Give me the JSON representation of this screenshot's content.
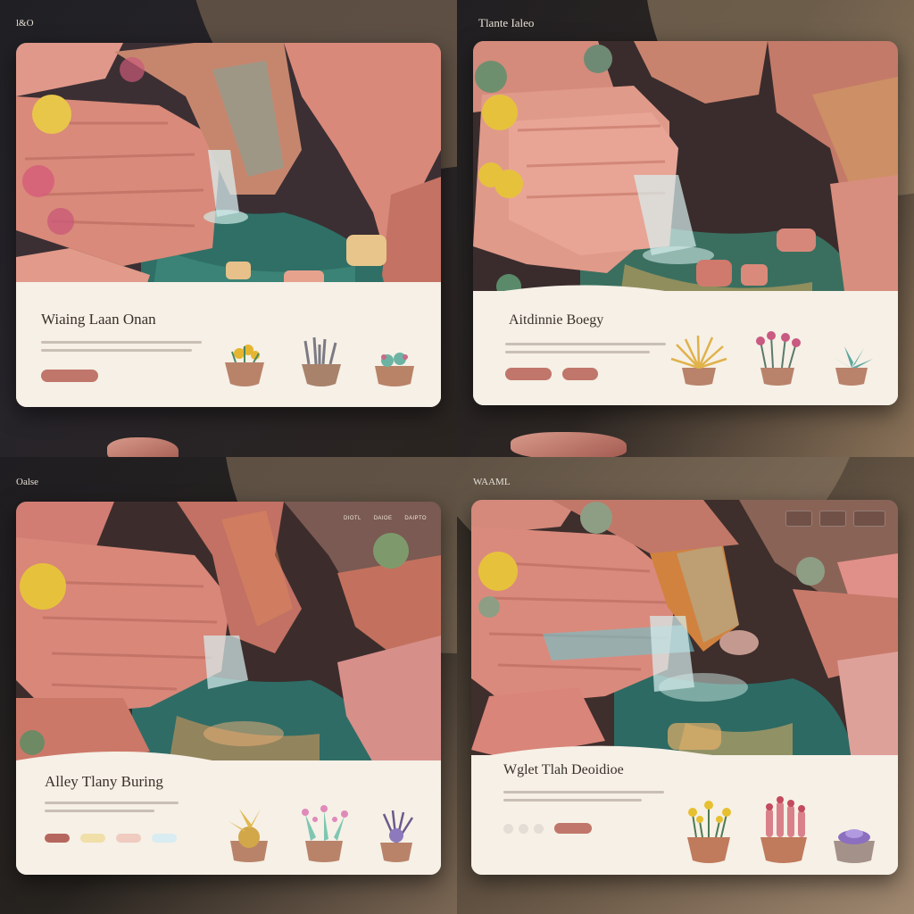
{
  "screens": [
    {
      "brand": "l&O",
      "nav": [
        "",
        "",
        "",
        ""
      ],
      "hero_nav": [
        "",
        "",
        ""
      ],
      "headline": "Wiaing Laan Onan",
      "buttons": 1,
      "pots": [
        "yellow-flower-pot",
        "lavender-pot",
        "succulent-pot"
      ]
    },
    {
      "brand": "Tlante Ialeo",
      "nav": [
        "",
        "",
        "",
        "",
        "",
        ""
      ],
      "headline": "Aitdinnie Boegy",
      "buttons": 2,
      "pots": [
        "golden-grass-pot",
        "pink-flower-pot",
        "agave-pot"
      ]
    },
    {
      "brand": "Oalse",
      "nav": [
        "",
        "",
        ""
      ],
      "hero_nav": [
        "DIOTL",
        "DAIOE",
        "DAIPTO"
      ],
      "headline": "Alley Tlany Buring",
      "pots": [
        "yellow-succulent-pot",
        "cactus-flower-pot",
        "purple-flower-pot"
      ]
    },
    {
      "brand": "WAAML",
      "nav": [
        "",
        "",
        "",
        "",
        ""
      ],
      "headline": "Wglet Tlah Deoidioe",
      "pots": [
        "yellow-flower-pot",
        "red-cactus-pot",
        "purple-succulent-pot"
      ]
    }
  ],
  "colors": {
    "cream": "#f6f0e6",
    "terracotta": "#c0766a",
    "rock": "#d58a78",
    "water": "#2f6b62"
  }
}
